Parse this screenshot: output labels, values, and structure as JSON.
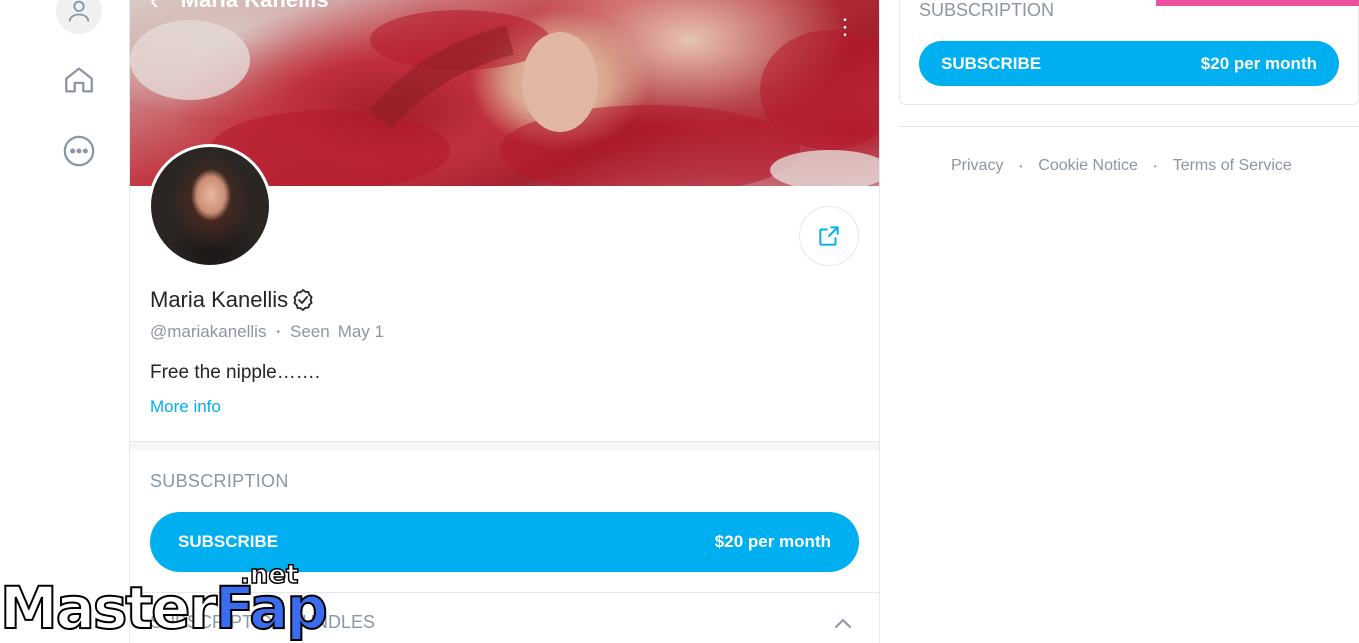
{
  "header": {
    "back_icon": "chevron-left-icon",
    "title": "Maria Kanellis",
    "more_icon": "vertical-dots-icon"
  },
  "nav": {
    "items": [
      {
        "icon": "user-icon"
      },
      {
        "icon": "home-icon"
      },
      {
        "icon": "more-circle-icon"
      }
    ]
  },
  "profile": {
    "name": "Maria Kanellis",
    "handle": "@mariakanellis",
    "seen_label": "Seen",
    "seen_date": "May 1",
    "bio": "Free the nipple…….",
    "more_info": "More info",
    "share_icon": "share-icon"
  },
  "subscription": {
    "title": "SUBSCRIPTION",
    "button_label": "SUBSCRIBE",
    "price": "$20 per month"
  },
  "bundles": {
    "title": "SUBSCRIPTION BUNDLES"
  },
  "right": {
    "subscription_title": "SUBSCRIPTION",
    "button_label": "SUBSCRIBE",
    "price": "$20 per month"
  },
  "footer": {
    "links": [
      "Privacy",
      "Cookie Notice",
      "Terms of Service"
    ]
  },
  "watermark": {
    "text_a": "Master",
    "text_b": "Fap",
    "suffix": ".net"
  },
  "colors": {
    "accent": "#00aff0",
    "muted": "#8a96a3",
    "pink": "#ee4f9f"
  }
}
